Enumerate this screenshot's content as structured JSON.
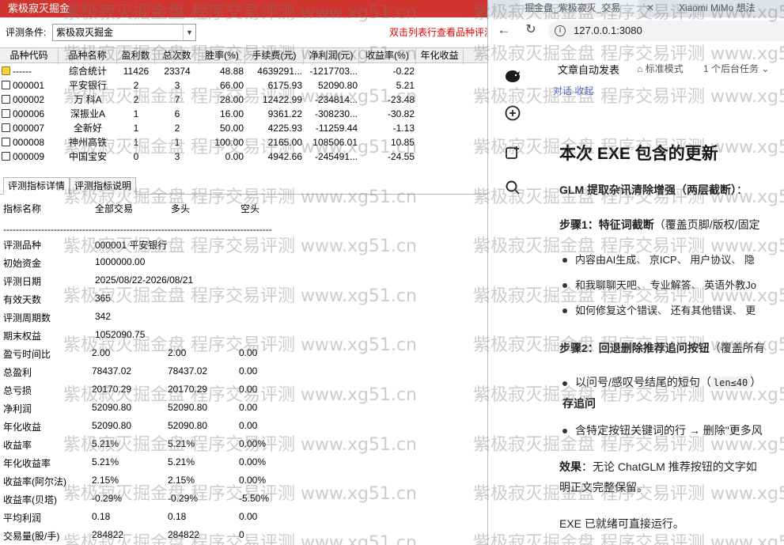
{
  "left_app": {
    "title": "紫极寂灭掘金",
    "criteria_label": "评测条件:",
    "criteria_value": "紫极寂灭掘金",
    "hint": "双击列表行查看品种评测",
    "columns": [
      "品种代码",
      "品种名称",
      "盈利数",
      "总次数",
      "胜率(%)",
      "手续费(元)",
      "净利润(元)",
      "收益率(%)",
      "年化收益"
    ],
    "rows": [
      {
        "code": "------",
        "name": "综合统计",
        "wins": "11426",
        "total": "23374",
        "winrate": "48.88",
        "fee": "4639291...",
        "profit": "-1217703...",
        "ret": "-0.22",
        "annual": "",
        "summary": true
      },
      {
        "code": "000001",
        "name": "平安银行",
        "wins": "2",
        "total": "3",
        "winrate": "66.00",
        "fee": "6175.93",
        "profit": "52090.80",
        "ret": "5.21",
        "annual": ""
      },
      {
        "code": "000002",
        "name": "万 科A",
        "wins": "2",
        "total": "7",
        "winrate": "28.00",
        "fee": "12422.99",
        "profit": "-234814...",
        "ret": "-23.48",
        "annual": ""
      },
      {
        "code": "000006",
        "name": "深振业A",
        "wins": "1",
        "total": "6",
        "winrate": "16.00",
        "fee": "9361.22",
        "profit": "-308230...",
        "ret": "-30.82",
        "annual": ""
      },
      {
        "code": "000007",
        "name": "全新好",
        "wins": "1",
        "total": "2",
        "winrate": "50.00",
        "fee": "4225.93",
        "profit": "-11259.44",
        "ret": "-1.13",
        "annual": ""
      },
      {
        "code": "000008",
        "name": "神州高铁",
        "wins": "1",
        "total": "1",
        "winrate": "100.00",
        "fee": "2165.00",
        "profit": "108506.01",
        "ret": "10.85",
        "annual": ""
      },
      {
        "code": "000009",
        "name": "中国宝安",
        "wins": "0",
        "total": "3",
        "winrate": "0.00",
        "fee": "4942.66",
        "profit": "-245491...",
        "ret": "-24.55",
        "annual": ""
      }
    ],
    "tabs": [
      "评测指标详情",
      "评测指标说明"
    ],
    "detail_header": {
      "name": "指标名称",
      "all": "全部交易",
      "long": "多头",
      "short": "空头"
    },
    "detail_separator": "-------------------------------------------------------------------------------------",
    "detail_info": [
      {
        "label": "评测品种",
        "value": "000001 平安银行"
      },
      {
        "label": "初始资金",
        "value": "1000000.00"
      },
      {
        "label": "评测日期",
        "value": "2025/08/22-2026/08/21"
      },
      {
        "label": "有效天数",
        "value": "365"
      },
      {
        "label": "评测周期数",
        "value": "342"
      },
      {
        "label": "期末权益",
        "value": "1052090.75"
      }
    ],
    "detail_metrics": [
      {
        "label": "盈亏时间比",
        "all": "2.00",
        "long": "2.00",
        "short": "0.00"
      },
      {
        "label": "总盈利",
        "all": "78437.02",
        "long": "78437.02",
        "short": "0.00"
      },
      {
        "label": "总亏损",
        "all": "20170.29",
        "long": "20170.29",
        "short": "0.00"
      },
      {
        "label": "净利润",
        "all": "52090.80",
        "long": "52090.80",
        "short": "0.00"
      },
      {
        "label": "年化收益",
        "all": "52090.80",
        "long": "52090.80",
        "short": "0.00"
      },
      {
        "label": "收益率",
        "all": "5.21%",
        "long": "5.21%",
        "short": "0.00%"
      },
      {
        "label": "年化收益率",
        "all": "5.21%",
        "long": "5.21%",
        "short": "0.00%"
      },
      {
        "label": "收益率(阿尔法)",
        "all": "2.15%",
        "long": "2.15%",
        "short": "0.00%"
      },
      {
        "label": "收益率(贝塔)",
        "all": "-0.29%",
        "long": "-0.29%",
        "short": "-5.50%"
      },
      {
        "label": "平均利润",
        "all": "0.18",
        "long": "0.18",
        "short": "0.00"
      },
      {
        "label": "交易量(股/手)",
        "all": "284822",
        "long": "284822",
        "short": "0"
      }
    ]
  },
  "browser": {
    "tab1_title": "掘金盘_紫极寂灭_交易",
    "tab2_title": "Xiaomi MiMo 想法",
    "url": "127.0.0.1:3080",
    "app_title": "文章自动发表",
    "mode_label": "标准模式",
    "tasks_label": "1 个后台任务",
    "top_snippet": "对话    收起",
    "heading": "本次 EXE 包含的更新",
    "p1_bold": "GLM 提取杂讯清除增强（两层截断）",
    "p1_rest": "：",
    "step1_bold": "步骤1：特征词截断",
    "step1_rest": "（覆盖页脚/版权/固定",
    "bullets1": [
      [
        "内容由AI生成",
        "京ICP",
        "用户协议",
        "隐"
      ],
      [
        "和我聊聊天吧",
        "专业解答",
        "英语外教Jo"
      ],
      [
        "如何修复这个错误",
        "还有其他错误",
        "更"
      ]
    ],
    "step2_bold": "步骤2：回退删除推荐追问按钮",
    "step2_rest": "（覆盖所有",
    "bullet2_prefix": "以问号/感叹号结尾的短句（",
    "bullet2_code": "len≤40",
    "bullet2_suffix": "）",
    "sub_heading": "存追问",
    "bullet3": "含特定按钮关键词的行 → 删除\"更多风",
    "effect_bold": "效果",
    "effect_rest": "：无论 ChatGLM 推荐按钮的文字如",
    "effect_line2": "明正文完整保留。",
    "ready": "EXE 已就绪可直接运行。"
  },
  "watermark": "紫极寂灭掘金盘 程序交易评测 www.xg51.cn"
}
